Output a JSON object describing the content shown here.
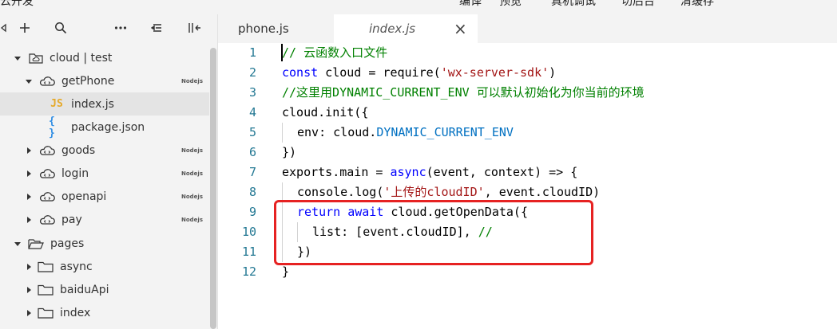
{
  "app": {
    "title": "云开发"
  },
  "topbar": {
    "menus": [
      {
        "label": "编译"
      },
      {
        "label": "预览"
      },
      {
        "label": "真机调试"
      },
      {
        "label": "切后台"
      },
      {
        "label": "清缓存"
      }
    ]
  },
  "toolbar": {
    "icons": [
      "collapse-left-icon",
      "add-icon",
      "search-icon",
      "more-icon",
      "sort-icon",
      "split-icon"
    ]
  },
  "tree": {
    "items": [
      {
        "label": "cloud | test",
        "icon": "cloud-folder-icon",
        "arrow": "down",
        "level": 0,
        "badge": ""
      },
      {
        "label": "getPhone",
        "icon": "cloud-function-icon",
        "arrow": "down",
        "level": 1,
        "badge": "Nodejs"
      },
      {
        "label": "index.js",
        "icon": "js-file-icon",
        "arrow": "",
        "level": 2,
        "badge": "",
        "selected": true
      },
      {
        "label": "package.json",
        "icon": "json-file-icon",
        "arrow": "",
        "level": 2,
        "badge": ""
      },
      {
        "label": "goods",
        "icon": "cloud-function-icon",
        "arrow": "right",
        "level": 1,
        "badge": "Nodejs"
      },
      {
        "label": "login",
        "icon": "cloud-function-icon",
        "arrow": "right",
        "level": 1,
        "badge": "Nodejs"
      },
      {
        "label": "openapi",
        "icon": "cloud-function-icon",
        "arrow": "right",
        "level": 1,
        "badge": "Nodejs"
      },
      {
        "label": "pay",
        "icon": "cloud-function-icon",
        "arrow": "right",
        "level": 1,
        "badge": "Nodejs"
      },
      {
        "label": "pages",
        "icon": "folder-open-icon",
        "arrow": "down",
        "level": 0,
        "badge": ""
      },
      {
        "label": "async",
        "icon": "folder-icon",
        "arrow": "right",
        "level": 1,
        "badge": ""
      },
      {
        "label": "baiduApi",
        "icon": "folder-icon",
        "arrow": "right",
        "level": 1,
        "badge": ""
      },
      {
        "label": "index",
        "icon": "folder-icon",
        "arrow": "right",
        "level": 1,
        "badge": ""
      }
    ]
  },
  "tabs": [
    {
      "label": "phone.js",
      "active": false
    },
    {
      "label": "index.js",
      "active": true,
      "close": "×"
    }
  ],
  "editor": {
    "colors": {
      "comment": "#008000",
      "keyword": "#0000ff",
      "string": "#a31515",
      "constant": "#0070c1",
      "default": "#000000",
      "line_number": "#237893",
      "annotation": "#e62222"
    },
    "lines": [
      {
        "number": "1",
        "indent": 0,
        "tokens": [
          {
            "text": "// 云函数入口文件",
            "type": "comment"
          }
        ]
      },
      {
        "number": "2",
        "indent": 0,
        "tokens": [
          {
            "text": "const",
            "type": "keyword"
          },
          {
            "text": " cloud = require(",
            "type": "default"
          },
          {
            "text": "'wx-server-sdk'",
            "type": "string"
          },
          {
            "text": ")",
            "type": "default"
          }
        ]
      },
      {
        "number": "3",
        "indent": 0,
        "tokens": [
          {
            "text": "//这里用DYNAMIC_CURRENT_ENV 可以默认初始化为你当前的环境",
            "type": "comment"
          }
        ]
      },
      {
        "number": "4",
        "indent": 0,
        "tokens": [
          {
            "text": "cloud.init({",
            "type": "default"
          }
        ]
      },
      {
        "number": "5",
        "indent": 1,
        "tokens": [
          {
            "text": "env: cloud.",
            "type": "default"
          },
          {
            "text": "DYNAMIC_CURRENT_ENV",
            "type": "constant"
          }
        ]
      },
      {
        "number": "6",
        "indent": 0,
        "tokens": [
          {
            "text": "})",
            "type": "default"
          }
        ]
      },
      {
        "number": "7",
        "indent": 0,
        "tokens": [
          {
            "text": "exports.main = ",
            "type": "default"
          },
          {
            "text": "async",
            "type": "keyword"
          },
          {
            "text": "(event, context) => {",
            "type": "default"
          }
        ]
      },
      {
        "number": "8",
        "indent": 1,
        "tokens": [
          {
            "text": "console.log(",
            "type": "default"
          },
          {
            "text": "'上传的cloudID'",
            "type": "string"
          },
          {
            "text": ", event.cloudID)",
            "type": "default"
          }
        ]
      },
      {
        "number": "9",
        "indent": 1,
        "tokens": [
          {
            "text": "return",
            "type": "keyword"
          },
          {
            "text": " ",
            "type": "default"
          },
          {
            "text": "await",
            "type": "keyword"
          },
          {
            "text": " cloud.getOpenData({",
            "type": "default"
          }
        ]
      },
      {
        "number": "10",
        "indent": 2,
        "tokens": [
          {
            "text": "list: [event.cloudID], ",
            "type": "default"
          },
          {
            "text": "//",
            "type": "comment"
          }
        ]
      },
      {
        "number": "11",
        "indent": 1,
        "tokens": [
          {
            "text": "})",
            "type": "default"
          }
        ]
      },
      {
        "number": "12",
        "indent": 0,
        "tokens": [
          {
            "text": "}",
            "type": "default"
          }
        ]
      }
    ]
  }
}
